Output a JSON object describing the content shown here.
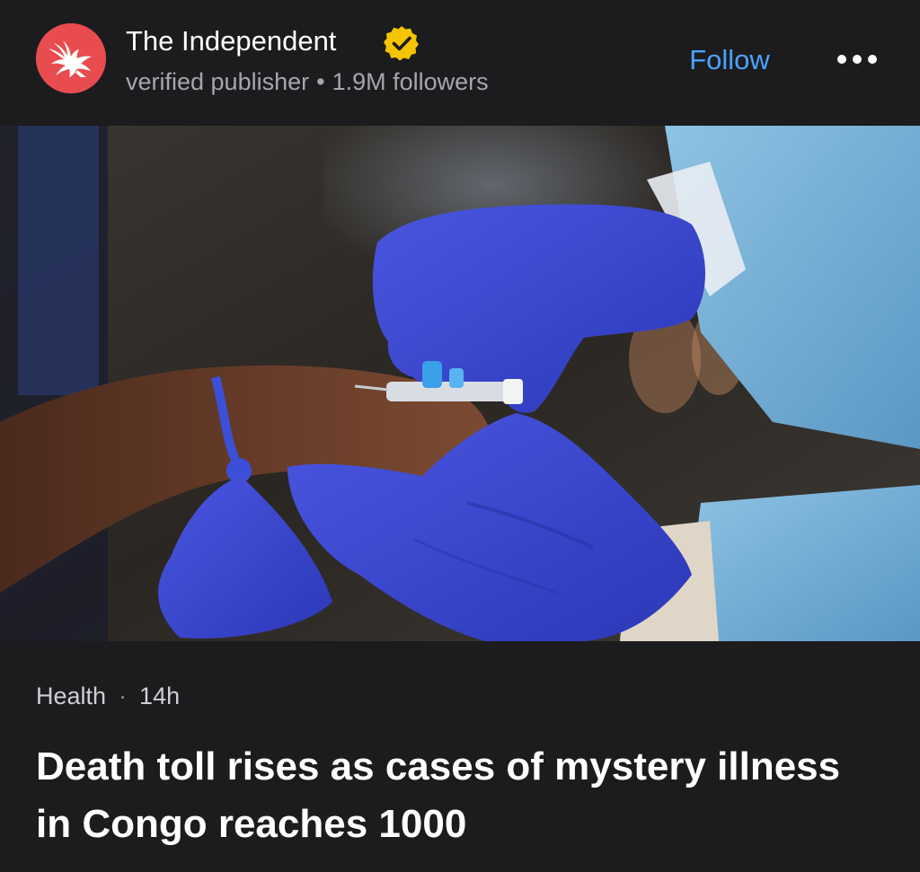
{
  "publisher": {
    "name": "The Independent",
    "subtitle": "verified publisher",
    "separator": "•",
    "followers": "1.9M followers",
    "avatar_icon": "independent-eagle-logo",
    "avatar_color": "#e84c4f",
    "badge_icon": "verified-check-badge",
    "badge_color": "#f5c400"
  },
  "actions": {
    "follow_label": "Follow",
    "follow_color": "#4aa3ff",
    "more_icon": "more-dots-icon"
  },
  "article": {
    "image_description_icon": "article-hero-image",
    "category": "Health",
    "meta_separator": "·",
    "age": "14h",
    "headline": "Death toll rises as cases of mystery illness in Congo reaches 1000"
  }
}
